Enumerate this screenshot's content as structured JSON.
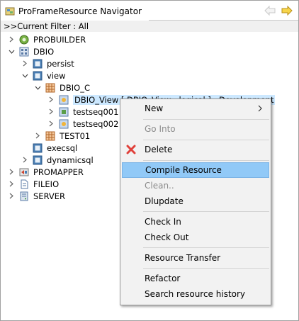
{
  "title": "ProFrameResource Navigator",
  "filter": ">>Current Filter : All",
  "tree": {
    "probuilder": "PROBUILDER",
    "dbio": "DBIO",
    "persist": "persist",
    "view": "view",
    "dbio_c": "DBIO_C",
    "dbio_view": "DBIO_View [ DBIO_View : logical ] : Development",
    "testseq001": "testseq001 [",
    "testseq002": "testseq002 [",
    "test01": "TEST01",
    "execsql": "execsql",
    "dynamicsql": "dynamicsql",
    "promapper": "PROMAPPER",
    "fileio": "FILEIO",
    "server": "SERVER"
  },
  "menu": {
    "new": "New",
    "go_into": "Go Into",
    "delete": "Delete",
    "compile": "Compile Resource",
    "clean": "Clean..",
    "dlupdate": "Dlupdate",
    "check_in": "Check In",
    "check_out": "Check Out",
    "resource_transfer": "Resource Transfer",
    "refactor": "Refactor",
    "search_history": "Search resource history"
  },
  "colors": {
    "selection": "#cce8ff",
    "menu_highlight": "#91c9f7",
    "menu_bg": "#f2f2f2",
    "delete_icon": "#e0403a"
  }
}
